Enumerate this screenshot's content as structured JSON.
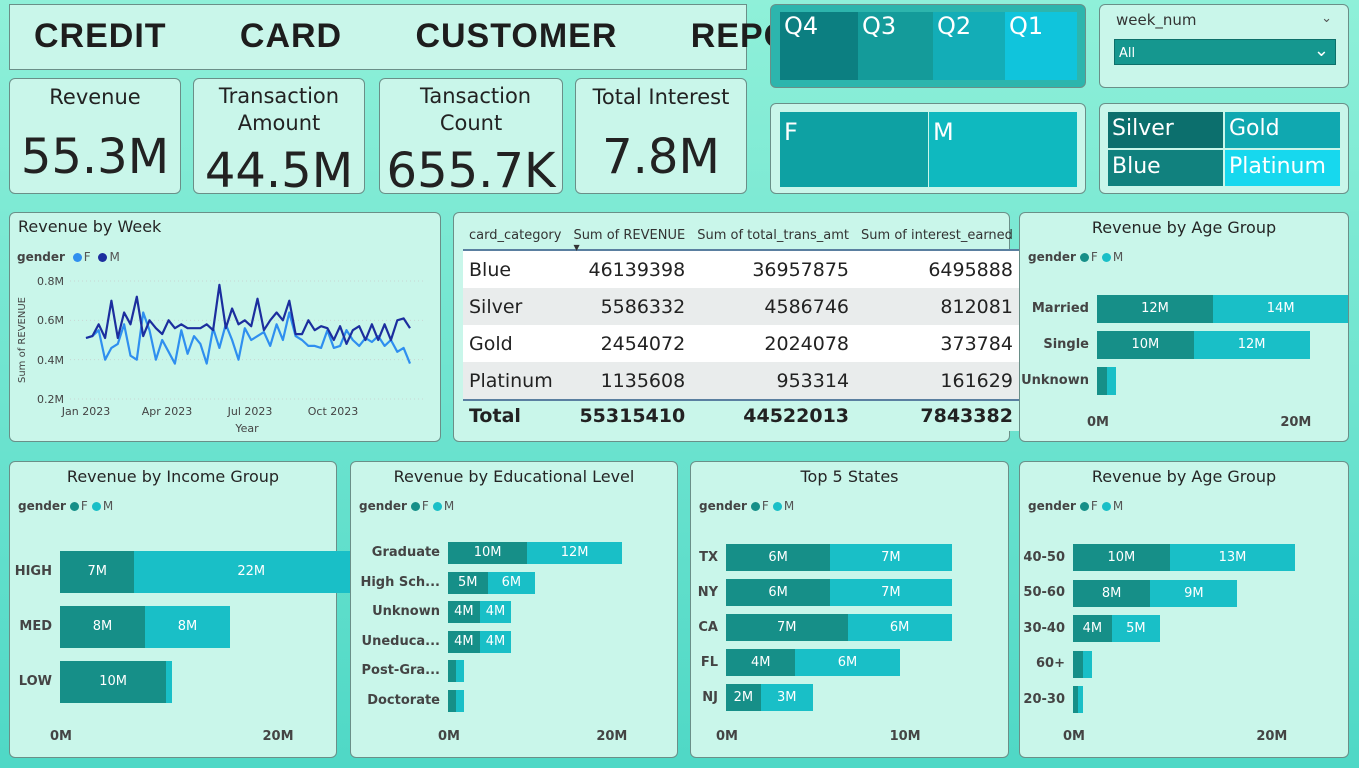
{
  "header": {
    "title": "CREDIT   CARD   CUSTOMER   REPORT"
  },
  "kpis": [
    {
      "label": "Revenue",
      "value": "55.3M"
    },
    {
      "label": "Transaction Amount",
      "value": "44.5M"
    },
    {
      "label": "Tansaction Count",
      "value": "655.7K"
    },
    {
      "label": "Total Interest",
      "value": "7.8M"
    }
  ],
  "quarter_slicer": {
    "items": [
      "Q4",
      "Q3",
      "Q2",
      "Q1"
    ]
  },
  "week_slicer": {
    "label": "week_num",
    "value": "All"
  },
  "gender_slicer": {
    "items": [
      "F",
      "M"
    ]
  },
  "category_slicer": {
    "items": [
      "Silver",
      "Gold",
      "Blue",
      "Platinum"
    ]
  },
  "colors": {
    "f": "#168f88",
    "m": "#19bfc7",
    "line_f": "#2f8fef",
    "line_m": "#1c2e9e"
  },
  "revenue_by_week": {
    "title": "Revenue by Week",
    "legend_title": "gender",
    "legend": [
      "F",
      "M"
    ],
    "ylabel": "Sum of REVENUE",
    "xlabel": "Year",
    "yticks": [
      "0.8M",
      "0.6M",
      "0.4M",
      "0.2M"
    ],
    "xticks": [
      "Jan 2023",
      "Apr 2023",
      "Jul 2023",
      "Oct 2023"
    ]
  },
  "matrix": {
    "headers": [
      "card_category",
      "Sum of REVENUE",
      "Sum of total_trans_amt",
      "Sum of interest_earned"
    ],
    "rows": [
      [
        "Blue",
        "46139398",
        "36957875",
        "6495888"
      ],
      [
        "Silver",
        "5586332",
        "4586746",
        "812081"
      ],
      [
        "Gold",
        "2454072",
        "2024078",
        "373784"
      ],
      [
        "Platinum",
        "1135608",
        "953314",
        "161629"
      ]
    ],
    "total": [
      "Total",
      "55315410",
      "44522013",
      "7843382"
    ]
  },
  "age_group_marital": {
    "title": "Revenue by Age Group",
    "legend_title": "gender",
    "legend": [
      "F",
      "M"
    ],
    "ticks": [
      "0M",
      "20M"
    ],
    "rows": [
      {
        "label": "Married",
        "f_label": "12M",
        "m_label": "14M"
      },
      {
        "label": "Single",
        "f_label": "10M",
        "m_label": "12M"
      },
      {
        "label": "Unknown",
        "f_label": "",
        "m_label": ""
      }
    ]
  },
  "income_group": {
    "title": "Revenue by Income Group",
    "legend_title": "gender",
    "legend": [
      "F",
      "M"
    ],
    "ticks": [
      "0M",
      "20M"
    ],
    "rows": [
      {
        "label": "HIGH",
        "f_label": "7M",
        "m_label": "22M"
      },
      {
        "label": "MED",
        "f_label": "8M",
        "m_label": "8M"
      },
      {
        "label": "LOW",
        "f_label": "10M",
        "m_label": ""
      }
    ]
  },
  "education": {
    "title": "Revenue by Educational Level",
    "legend_title": "gender",
    "legend": [
      "F",
      "M"
    ],
    "ticks": [
      "0M",
      "20M"
    ],
    "rows": [
      {
        "label": "Graduate",
        "f_label": "10M",
        "m_label": "12M"
      },
      {
        "label": "High Sch...",
        "f_label": "5M",
        "m_label": "6M"
      },
      {
        "label": "Unknown",
        "f_label": "4M",
        "m_label": "4M"
      },
      {
        "label": "Uneduca...",
        "f_label": "4M",
        "m_label": "4M"
      },
      {
        "label": "Post-Gra...",
        "f_label": "",
        "m_label": ""
      },
      {
        "label": "Doctorate",
        "f_label": "",
        "m_label": ""
      }
    ]
  },
  "top_states": {
    "title": "Top 5 States",
    "legend_title": "gender",
    "legend": [
      "F",
      "M"
    ],
    "ticks": [
      "0M",
      "10M"
    ],
    "rows": [
      {
        "label": "TX",
        "f_label": "6M",
        "m_label": "7M"
      },
      {
        "label": "NY",
        "f_label": "6M",
        "m_label": "7M"
      },
      {
        "label": "CA",
        "f_label": "7M",
        "m_label": "6M"
      },
      {
        "label": "FL",
        "f_label": "4M",
        "m_label": "6M"
      },
      {
        "label": "NJ",
        "f_label": "2M",
        "m_label": "3M"
      }
    ]
  },
  "age_group_range": {
    "title": "Revenue by Age Group",
    "legend_title": "gender",
    "legend": [
      "F",
      "M"
    ],
    "ticks": [
      "0M",
      "20M"
    ],
    "rows": [
      {
        "label": "40-50",
        "f_label": "10M",
        "m_label": "13M"
      },
      {
        "label": "50-60",
        "f_label": "8M",
        "m_label": "9M"
      },
      {
        "label": "30-40",
        "f_label": "4M",
        "m_label": "5M"
      },
      {
        "label": "60+",
        "f_label": "",
        "m_label": ""
      },
      {
        "label": "20-30",
        "f_label": "",
        "m_label": ""
      }
    ]
  },
  "chart_data": [
    {
      "type": "line",
      "title": "Revenue by Week",
      "xlabel": "Year",
      "ylabel": "Sum of REVENUE",
      "ylim": [
        200000,
        800000
      ],
      "x": [
        "2023-01-01",
        "2023-01-08",
        "2023-01-15",
        "2023-01-22",
        "2023-01-29",
        "2023-02-05",
        "2023-02-12",
        "2023-02-19",
        "2023-02-26",
        "2023-03-05",
        "2023-03-12",
        "2023-03-19",
        "2023-03-26",
        "2023-04-02",
        "2023-04-09",
        "2023-04-16",
        "2023-04-23",
        "2023-04-30",
        "2023-05-07",
        "2023-05-14",
        "2023-05-21",
        "2023-05-28",
        "2023-06-04",
        "2023-06-11",
        "2023-06-18",
        "2023-06-25",
        "2023-07-02",
        "2023-07-09",
        "2023-07-16",
        "2023-07-23",
        "2023-07-30",
        "2023-08-06",
        "2023-08-13",
        "2023-08-20",
        "2023-08-27",
        "2023-09-03",
        "2023-09-10",
        "2023-09-17",
        "2023-09-24",
        "2023-10-01",
        "2023-10-08",
        "2023-10-15",
        "2023-10-22",
        "2023-10-29",
        "2023-11-05",
        "2023-11-12",
        "2023-11-19",
        "2023-11-26",
        "2023-12-03",
        "2023-12-10",
        "2023-12-17",
        "2023-12-24"
      ],
      "series": [
        {
          "name": "F",
          "values": [
            0.51,
            0.52,
            0.55,
            0.4,
            0.46,
            0.48,
            0.58,
            0.42,
            0.4,
            0.64,
            0.55,
            0.4,
            0.5,
            0.44,
            0.38,
            0.55,
            0.43,
            0.52,
            0.48,
            0.38,
            0.56,
            0.46,
            0.58,
            0.5,
            0.4,
            0.56,
            0.5,
            0.52,
            0.54,
            0.47,
            0.58,
            0.5,
            0.64,
            0.52,
            0.5,
            0.47,
            0.47,
            0.46,
            0.55,
            0.46,
            0.47,
            0.55,
            0.5,
            0.47,
            0.51,
            0.49,
            0.52,
            0.47,
            0.5,
            0.44,
            0.46,
            0.38
          ]
        },
        {
          "name": "M",
          "values": [
            0.51,
            0.52,
            0.58,
            0.51,
            0.7,
            0.51,
            0.64,
            0.58,
            0.72,
            0.52,
            0.6,
            0.56,
            0.53,
            0.6,
            0.56,
            0.58,
            0.56,
            0.56,
            0.56,
            0.58,
            0.55,
            0.78,
            0.56,
            0.66,
            0.58,
            0.6,
            0.57,
            0.71,
            0.55,
            0.6,
            0.64,
            0.6,
            0.7,
            0.53,
            0.53,
            0.6,
            0.55,
            0.57,
            0.56,
            0.5,
            0.57,
            0.48,
            0.55,
            0.57,
            0.5,
            0.58,
            0.5,
            0.58,
            0.5,
            0.6,
            0.61,
            0.56
          ]
        }
      ]
    },
    {
      "type": "table",
      "columns": [
        "card_category",
        "Sum of REVENUE",
        "Sum of total_trans_amt",
        "Sum of interest_earned"
      ],
      "rows": [
        [
          "Blue",
          46139398,
          36957875,
          6495888
        ],
        [
          "Silver",
          5586332,
          4586746,
          812081
        ],
        [
          "Gold",
          2454072,
          2024078,
          373784
        ],
        [
          "Platinum",
          1135608,
          953314,
          161629
        ]
      ],
      "total": [
        "Total",
        55315410,
        44522013,
        7843382
      ]
    },
    {
      "type": "bar",
      "title": "Revenue by Age Group",
      "xlim": [
        0,
        24
      ],
      "categories": [
        "Married",
        "Single",
        "Unknown"
      ],
      "series": [
        {
          "name": "F",
          "values": [
            12,
            10,
            1
          ]
        },
        {
          "name": "M",
          "values": [
            14,
            12,
            1
          ]
        }
      ]
    },
    {
      "type": "bar",
      "title": "Revenue by Income Group",
      "xlim": [
        0,
        24
      ],
      "categories": [
        "HIGH",
        "MED",
        "LOW"
      ],
      "series": [
        {
          "name": "F",
          "values": [
            7,
            8,
            10
          ]
        },
        {
          "name": "M",
          "values": [
            22,
            8,
            0.5
          ]
        }
      ]
    },
    {
      "type": "bar",
      "title": "Revenue by Educational Level",
      "xlim": [
        0,
        24
      ],
      "categories": [
        "Graduate",
        "High Sch...",
        "Unknown",
        "Uneduca...",
        "Post-Gra...",
        "Doctorate"
      ],
      "series": [
        {
          "name": "F",
          "values": [
            10,
            5,
            4,
            4,
            1,
            1
          ]
        },
        {
          "name": "M",
          "values": [
            12,
            6,
            4,
            4,
            1,
            1
          ]
        }
      ]
    },
    {
      "type": "bar",
      "title": "Top 5 States",
      "xlim": [
        0,
        14
      ],
      "categories": [
        "TX",
        "NY",
        "CA",
        "FL",
        "NJ"
      ],
      "series": [
        {
          "name": "F",
          "values": [
            6,
            6,
            7,
            4,
            2
          ]
        },
        {
          "name": "M",
          "values": [
            7,
            7,
            6,
            6,
            3
          ]
        }
      ]
    },
    {
      "type": "bar",
      "title": "Revenue by Age Group",
      "xlim": [
        0,
        24
      ],
      "categories": [
        "40-50",
        "50-60",
        "30-40",
        "60+",
        "20-30"
      ],
      "series": [
        {
          "name": "F",
          "values": [
            10,
            8,
            4,
            1,
            0.5
          ]
        },
        {
          "name": "M",
          "values": [
            13,
            9,
            5,
            1,
            0.5
          ]
        }
      ]
    }
  ]
}
